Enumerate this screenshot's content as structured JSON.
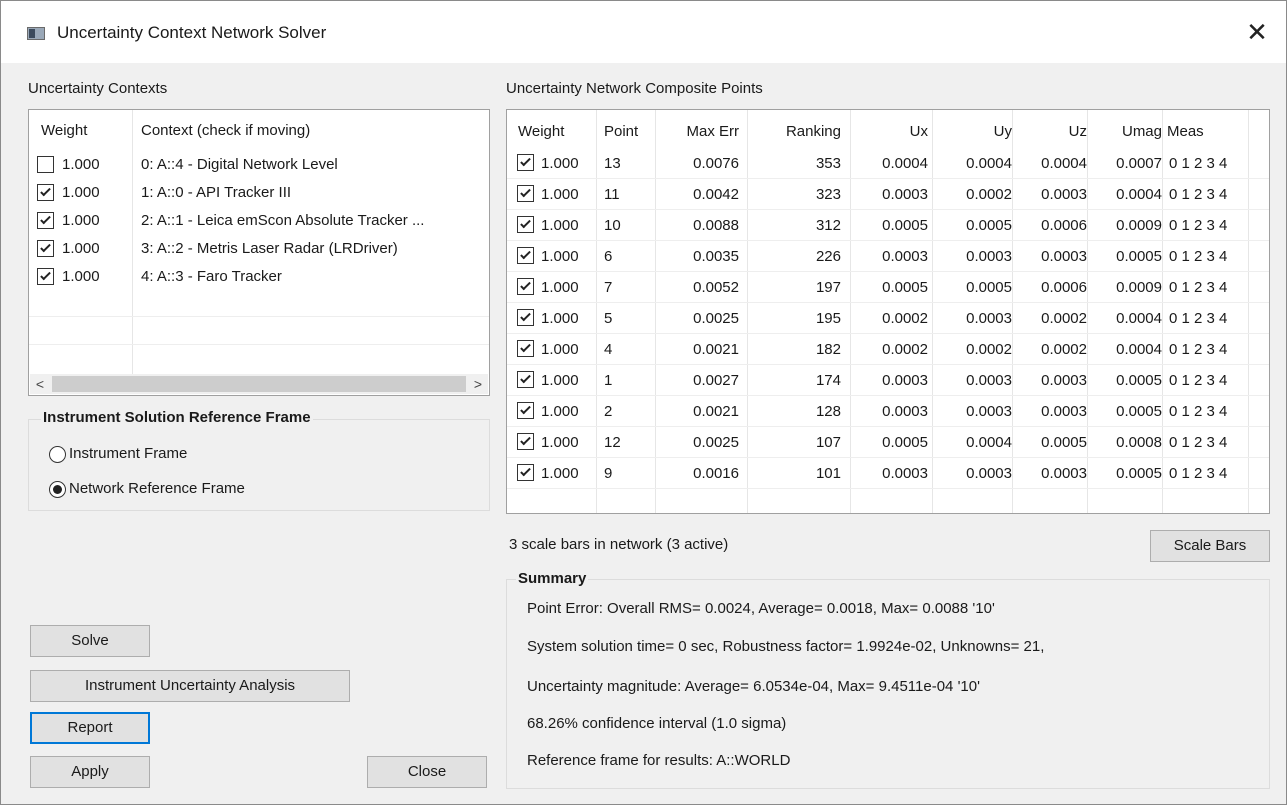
{
  "window": {
    "title": "Uncertainty Context Network Solver",
    "close_glyph": "✕"
  },
  "contexts": {
    "label": "Uncertainty Contexts",
    "headers": {
      "weight": "Weight",
      "context": "Context (check if moving)"
    },
    "rows": [
      {
        "checked": false,
        "weight": "1.000",
        "context": "0: A::4 - Digital Network Level"
      },
      {
        "checked": true,
        "weight": "1.000",
        "context": "1: A::0 - API Tracker III"
      },
      {
        "checked": true,
        "weight": "1.000",
        "context": "2: A::1 - Leica emScon Absolute Tracker ..."
      },
      {
        "checked": true,
        "weight": "1.000",
        "context": "3: A::2 - Metris Laser Radar (LRDriver)"
      },
      {
        "checked": true,
        "weight": "1.000",
        "context": "4: A::3 - Faro Tracker"
      }
    ],
    "scroll_left": "<",
    "scroll_right": ">"
  },
  "frame_group": {
    "title": "Instrument Solution Reference Frame",
    "options": [
      {
        "label": "Instrument Frame",
        "selected": false
      },
      {
        "label": "Network Reference Frame",
        "selected": true
      }
    ]
  },
  "points": {
    "label": "Uncertainty Network Composite Points",
    "headers": {
      "weight": "Weight",
      "point": "Point",
      "max_err": "Max Err",
      "ranking": "Ranking",
      "ux": "Ux",
      "uy": "Uy",
      "uz": "Uz",
      "umag": "Umag",
      "meas": "Meas"
    },
    "rows": [
      {
        "checked": true,
        "weight": "1.000",
        "point": "13",
        "max_err": "0.0076",
        "ranking": "353",
        "ux": "0.0004",
        "uy": "0.0004",
        "uz": "0.0004",
        "umag": "0.0007",
        "meas": "0 1 2 3 4"
      },
      {
        "checked": true,
        "weight": "1.000",
        "point": "11",
        "max_err": "0.0042",
        "ranking": "323",
        "ux": "0.0003",
        "uy": "0.0002",
        "uz": "0.0003",
        "umag": "0.0004",
        "meas": "0 1 2 3 4"
      },
      {
        "checked": true,
        "weight": "1.000",
        "point": "10",
        "max_err": "0.0088",
        "ranking": "312",
        "ux": "0.0005",
        "uy": "0.0005",
        "uz": "0.0006",
        "umag": "0.0009",
        "meas": "0 1 2 3 4"
      },
      {
        "checked": true,
        "weight": "1.000",
        "point": "6",
        "max_err": "0.0035",
        "ranking": "226",
        "ux": "0.0003",
        "uy": "0.0003",
        "uz": "0.0003",
        "umag": "0.0005",
        "meas": "0 1 2 3 4"
      },
      {
        "checked": true,
        "weight": "1.000",
        "point": "7",
        "max_err": "0.0052",
        "ranking": "197",
        "ux": "0.0005",
        "uy": "0.0005",
        "uz": "0.0006",
        "umag": "0.0009",
        "meas": "0 1 2 3 4"
      },
      {
        "checked": true,
        "weight": "1.000",
        "point": "5",
        "max_err": "0.0025",
        "ranking": "195",
        "ux": "0.0002",
        "uy": "0.0003",
        "uz": "0.0002",
        "umag": "0.0004",
        "meas": "0 1 2 3 4"
      },
      {
        "checked": true,
        "weight": "1.000",
        "point": "4",
        "max_err": "0.0021",
        "ranking": "182",
        "ux": "0.0002",
        "uy": "0.0002",
        "uz": "0.0002",
        "umag": "0.0004",
        "meas": "0 1 2 3 4"
      },
      {
        "checked": true,
        "weight": "1.000",
        "point": "1",
        "max_err": "0.0027",
        "ranking": "174",
        "ux": "0.0003",
        "uy": "0.0003",
        "uz": "0.0003",
        "umag": "0.0005",
        "meas": "0 1 2 3 4"
      },
      {
        "checked": true,
        "weight": "1.000",
        "point": "2",
        "max_err": "0.0021",
        "ranking": "128",
        "ux": "0.0003",
        "uy": "0.0003",
        "uz": "0.0003",
        "umag": "0.0005",
        "meas": "0 1 2 3 4"
      },
      {
        "checked": true,
        "weight": "1.000",
        "point": "12",
        "max_err": "0.0025",
        "ranking": "107",
        "ux": "0.0005",
        "uy": "0.0004",
        "uz": "0.0005",
        "umag": "0.0008",
        "meas": "0 1 2 3 4"
      },
      {
        "checked": true,
        "weight": "1.000",
        "point": "9",
        "max_err": "0.0016",
        "ranking": "101",
        "ux": "0.0003",
        "uy": "0.0003",
        "uz": "0.0003",
        "umag": "0.0005",
        "meas": "0 1 2 3 4"
      }
    ]
  },
  "scale_status": "3 scale bars in network (3 active)",
  "summary": {
    "title": "Summary",
    "lines": [
      "Point Error: Overall RMS= 0.0024, Average= 0.0018, Max= 0.0088 '10'",
      "System solution time= 0 sec, Robustness factor= 1.9924e-02, Unknowns= 21,",
      "Uncertainty magnitude: Average= 6.0534e-04, Max= 9.4511e-04 '10'",
      "68.26% confidence interval (1.0 sigma)",
      "Reference frame for results: A::WORLD"
    ]
  },
  "buttons": {
    "solve": "Solve",
    "instrument_analysis": "Instrument Uncertainty Analysis",
    "report": "Report",
    "apply": "Apply",
    "close": "Close",
    "scale_bars": "Scale Bars"
  }
}
